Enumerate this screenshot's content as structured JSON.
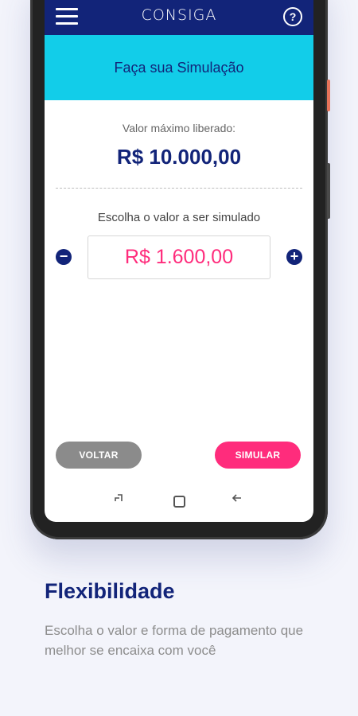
{
  "app": {
    "logo_text": "CONSIGA",
    "banner_title": "Faça sua Simulação"
  },
  "simulation": {
    "max_label": "Valor máximo liberado:",
    "max_value": "R$ 10.000,00",
    "choose_label": "Escolha o valor a ser simulado",
    "amount": "R$ 1.600,00",
    "minus_symbol": "−",
    "plus_symbol": "+"
  },
  "actions": {
    "back_label": "VOLTAR",
    "simulate_label": "SIMULAR"
  },
  "navigation": {
    "recent_icon": "recent-apps-icon",
    "home_icon": "home-icon",
    "back_icon": "back-arrow-icon"
  },
  "promo": {
    "title": "Flexibilidade",
    "description": "Escolha o valor e forma de pagamento que melhor se encaixa com você"
  },
  "colors": {
    "primary": "#122479",
    "banner": "#12cde9",
    "accent": "#ff2c7c",
    "secondary_button": "#8b8b8b",
    "background": "#f3f4fb"
  }
}
